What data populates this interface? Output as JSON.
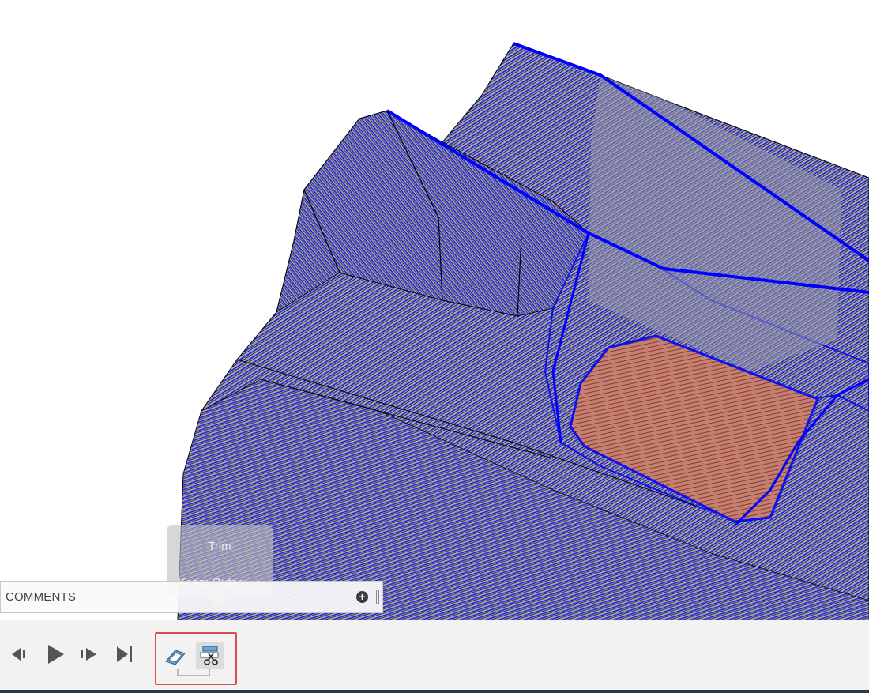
{
  "canvas": {
    "icons": [
      "3d-model-toolpath"
    ],
    "colors": {
      "toolpath": "#1515e6",
      "surface": "#a8a8a8",
      "selected_face": "#c97a6a",
      "background": "#ffffff"
    }
  },
  "tooltip": {
    "title": "Trim",
    "detail": "Keep: Outer"
  },
  "comments": {
    "label": "COMMENTS",
    "add_icon": "plus-circle-icon",
    "pin_icon": "panel-pin-icon"
  },
  "timeline": {
    "controls": [
      "step-back-icon",
      "play-icon",
      "step-forward-icon",
      "go-to-end-icon"
    ],
    "features": [
      {
        "icon": "surface-feature-icon"
      },
      {
        "icon": "trim-feature-icon",
        "selected": true
      }
    ],
    "highlight_color": "#e04a4a",
    "background": "#f2f2f2"
  }
}
